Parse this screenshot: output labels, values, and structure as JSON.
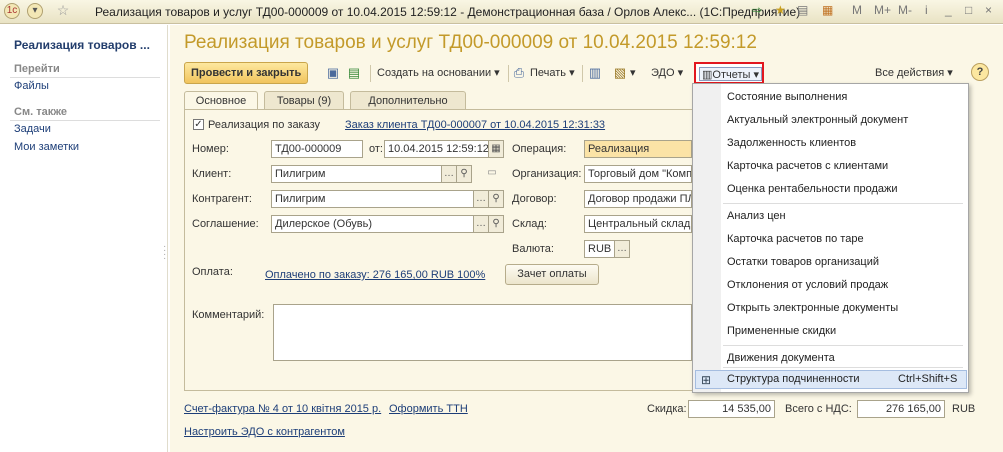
{
  "window": {
    "title": "Реализация товаров и услуг ТД00-000009 от 10.04.2015 12:59:12 - Демонстрационная база / Орлов Алекс... (1С:Предприятие)",
    "controls": [
      "M",
      "M+",
      "M-",
      "i",
      "_",
      "□",
      "×"
    ]
  },
  "sidebar": {
    "title": "Реализация товаров ...",
    "section_go": "Перейти",
    "go_items": [
      "Файлы"
    ],
    "section_see_also": "См. также",
    "see_also_items": [
      "Задачи",
      "Мои заметки"
    ]
  },
  "document": {
    "title": "Реализация товаров и услуг ТД00-000009 от 10.04.2015 12:59:12"
  },
  "toolbar": {
    "post_close": "Провести и закрыть",
    "create_based": "Создать на основании",
    "print": "Печать",
    "edo": "ЭДО",
    "reports": "Отчеты",
    "all_actions": "Все действия",
    "help": "?"
  },
  "tabs": [
    "Основное",
    "Товары (9)",
    "Дополнительно"
  ],
  "form": {
    "by_order_label": "Реализация по заказу",
    "order_link": "Заказ клиента ТД00-000007 от 10.04.2015 12:31:33",
    "number_label": "Номер:",
    "number_value": "ТД00-000009",
    "date_label": "от:",
    "date_value": "10.04.2015 12:59:12",
    "client_label": "Клиент:",
    "client_value": "Пилигрим",
    "counterparty_label": "Контрагент:",
    "counterparty_value": "Пилигрим",
    "agreement_label": "Соглашение:",
    "agreement_value": "Дилерское (Обувь)",
    "operation_label": "Операция:",
    "operation_value": "Реализация",
    "organization_label": "Организация:",
    "organization_value": "Торговый дом \"Комп",
    "contract_label": "Договор:",
    "contract_value": "Договор продажи ПЛ",
    "warehouse_label": "Склад:",
    "warehouse_value": "Центральный склад",
    "currency_label": "Валюта:",
    "currency_value": "RUB",
    "payment_label": "Оплата:",
    "payment_link": "Оплачено по заказу: 276 165,00 RUB  100%",
    "offset_button": "Зачет оплаты",
    "comment_label": "Комментарий:"
  },
  "footer": {
    "invoice_link": "Счет-фактура № 4 от 10 квітня 2015 р.",
    "ttn_link": "Оформить ТТН",
    "edo_setup_link": "Настроить ЭДО с контрагентом",
    "discount_label": "Скидка:",
    "discount_value": "14 535,00",
    "total_label": "Всего с НДС:",
    "total_value": "276 165,00",
    "currency": "RUB"
  },
  "reports_menu": {
    "group1": [
      "Состояние выполнения",
      "Актуальный электронный документ",
      "Задолженность клиентов",
      "Карточка расчетов с клиентами",
      "Оценка рентабельности продажи"
    ],
    "group2": [
      "Анализ цен",
      "Карточка расчетов по таре",
      "Остатки товаров организаций",
      "Отклонения от условий продаж",
      "Открыть электронные документы",
      "Примененные скидки"
    ],
    "group3": [
      "Движения документа"
    ],
    "highlighted": {
      "label": "Структура подчиненности",
      "shortcut": "Ctrl+Shift+S"
    }
  }
}
